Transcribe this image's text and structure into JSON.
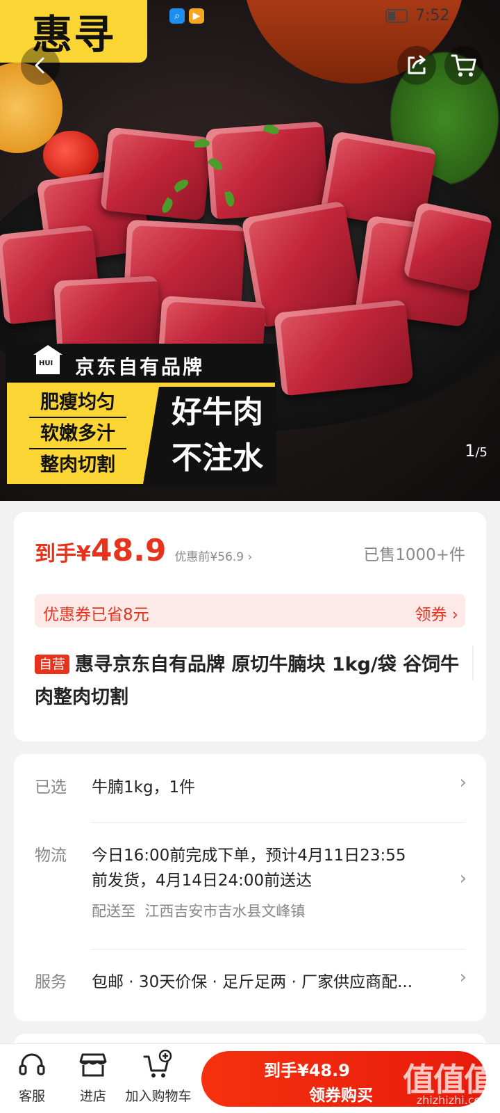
{
  "status_bar": {
    "time": "7:52",
    "app_logo": "惠寻"
  },
  "hero": {
    "brand_banner": "京东自有品牌",
    "brand_badge": "HUI",
    "features": [
      "肥瘦均匀",
      "软嫩多汁",
      "整肉切割"
    ],
    "slogan_line1": "好牛肉",
    "slogan_line2": "不注水",
    "page_current": "1",
    "page_total": "/5"
  },
  "price": {
    "prefix": "到手¥",
    "value": "48.9",
    "original": "优惠前¥56.9 ›",
    "sold": "已售1000+件"
  },
  "coupon": {
    "text": "优惠券已省8元",
    "action": "领券 ›"
  },
  "product": {
    "tag": "自营",
    "title": "惠寻京东自有品牌 原切牛腩块 1kg/袋 谷饲牛肉整肉切割"
  },
  "details": {
    "selected_label": "已选",
    "selected_value": "牛腩1kg，1件",
    "logistics_label": "物流",
    "logistics_line1": "今日16:00前完成下单，预计4月11日23:55",
    "logistics_line2": "前发货，4月14日24:00前送达",
    "ship_to_label": "配送至",
    "ship_to_value": "江西吉安市吉水县文峰镇",
    "service_label": "服务",
    "service_value": "包邮 · 30天价保 · 足斤足两 · 厂家供应商配..."
  },
  "bottom_bar": {
    "service": "客服",
    "store": "进店",
    "add_cart": "加入购物车",
    "buy_price": "到手¥48.9",
    "buy_label": "领券购买"
  },
  "watermark": {
    "main": "值值值",
    "sub": "zhizhizhi.com"
  },
  "colors": {
    "accent": "#e8331c",
    "brand_yellow": "#fbd533"
  },
  "icons": [
    "back-icon",
    "share-icon",
    "cart-icon",
    "headset-icon",
    "store-icon",
    "add-cart-icon",
    "chevron-right-icon"
  ]
}
